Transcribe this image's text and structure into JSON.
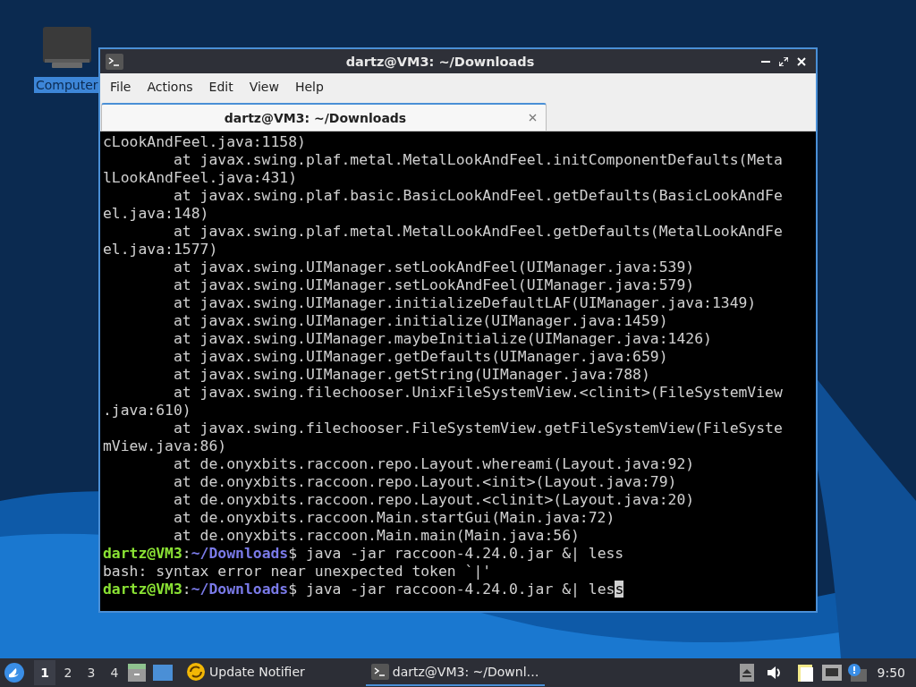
{
  "desktop_icons": [
    {
      "label": "Computer",
      "selected": true
    }
  ],
  "window": {
    "title": "dartz@VM3: ~/Downloads",
    "menu": [
      "File",
      "Actions",
      "Edit",
      "View",
      "Help"
    ],
    "tabs": [
      {
        "label": "dartz@VM3: ~/Downloads",
        "selected": true
      }
    ],
    "terminal": {
      "lines": [
        {
          "kind": "output",
          "text": "cLookAndFeel.java:1158)"
        },
        {
          "kind": "output",
          "text": "        at javax.swing.plaf.metal.MetalLookAndFeel.initComponentDefaults(Meta"
        },
        {
          "kind": "output",
          "text": "lLookAndFeel.java:431)"
        },
        {
          "kind": "output",
          "text": "        at javax.swing.plaf.basic.BasicLookAndFeel.getDefaults(BasicLookAndFe"
        },
        {
          "kind": "output",
          "text": "el.java:148)"
        },
        {
          "kind": "output",
          "text": "        at javax.swing.plaf.metal.MetalLookAndFeel.getDefaults(MetalLookAndFe"
        },
        {
          "kind": "output",
          "text": "el.java:1577)"
        },
        {
          "kind": "output",
          "text": "        at javax.swing.UIManager.setLookAndFeel(UIManager.java:539)"
        },
        {
          "kind": "output",
          "text": "        at javax.swing.UIManager.setLookAndFeel(UIManager.java:579)"
        },
        {
          "kind": "output",
          "text": "        at javax.swing.UIManager.initializeDefaultLAF(UIManager.java:1349)"
        },
        {
          "kind": "output",
          "text": "        at javax.swing.UIManager.initialize(UIManager.java:1459)"
        },
        {
          "kind": "output",
          "text": "        at javax.swing.UIManager.maybeInitialize(UIManager.java:1426)"
        },
        {
          "kind": "output",
          "text": "        at javax.swing.UIManager.getDefaults(UIManager.java:659)"
        },
        {
          "kind": "output",
          "text": "        at javax.swing.UIManager.getString(UIManager.java:788)"
        },
        {
          "kind": "output",
          "text": "        at javax.swing.filechooser.UnixFileSystemView.<clinit>(FileSystemView"
        },
        {
          "kind": "output",
          "text": ".java:610)"
        },
        {
          "kind": "output",
          "text": "        at javax.swing.filechooser.FileSystemView.getFileSystemView(FileSyste"
        },
        {
          "kind": "output",
          "text": "mView.java:86)"
        },
        {
          "kind": "output",
          "text": "        at de.onyxbits.raccoon.repo.Layout.whereami(Layout.java:92)"
        },
        {
          "kind": "output",
          "text": "        at de.onyxbits.raccoon.repo.Layout.<init>(Layout.java:79)"
        },
        {
          "kind": "output",
          "text": "        at de.onyxbits.raccoon.repo.Layout.<clinit>(Layout.java:20)"
        },
        {
          "kind": "output",
          "text": "        at de.onyxbits.raccoon.Main.startGui(Main.java:72)"
        },
        {
          "kind": "output",
          "text": "        at de.onyxbits.raccoon.Main.main(Main.java:56)"
        },
        {
          "kind": "prompt",
          "user": "dartz@VM3",
          "separator": ":",
          "path": "~/Downloads",
          "dollar": "$",
          "command": " java -jar raccoon-4.24.0.jar &| less"
        },
        {
          "kind": "output",
          "text": "bash: syntax error near unexpected token `|'"
        },
        {
          "kind": "prompt",
          "user": "dartz@VM3",
          "separator": ":",
          "path": "~/Downloads",
          "dollar": "$",
          "command": " java -jar raccoon-4.24.0.jar &| les",
          "cursor": "s"
        }
      ]
    }
  },
  "taskbar": {
    "workspaces": [
      {
        "label": "1",
        "selected": true
      },
      {
        "label": "2",
        "selected": false
      },
      {
        "label": "3",
        "selected": false
      },
      {
        "label": "4",
        "selected": false
      }
    ],
    "tasks": [
      {
        "kind": "updater",
        "label": "Update Notifier",
        "selected": false
      },
      {
        "kind": "terminal",
        "label": "dartz@VM3: ~/Downl…",
        "selected": true
      }
    ],
    "clock": "9:50"
  }
}
